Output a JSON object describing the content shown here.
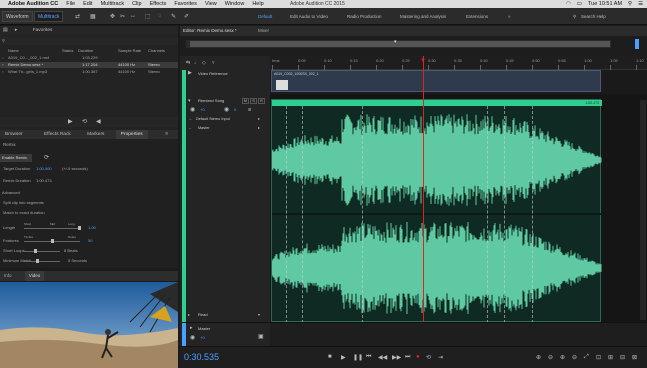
{
  "menubar": {
    "app": "Adobe Audition CC",
    "items": [
      "File",
      "Edit",
      "Multitrack",
      "Clip",
      "Effects",
      "Favorites",
      "View",
      "Window",
      "Help"
    ],
    "title": "Adobe Audition CC 2015",
    "clock": "Tue 10:51 AM"
  },
  "toolbar": {
    "waveform": "Waveform",
    "multitrack": "Multitrack",
    "workspaces": [
      "Default",
      "Edit Audio to Video",
      "Radio Production",
      "Mastering and Analysis",
      "Extensions"
    ],
    "search": "Search Help"
  },
  "files": {
    "title": "Favorites",
    "cols": [
      "Name",
      "Status",
      "Duration",
      "Sample Rate",
      "Channels"
    ],
    "rows": [
      {
        "name": "A019_C0..._002_1.mxf",
        "status": "",
        "duration": "1:03.229",
        "rate": "",
        "ch": ""
      },
      {
        "name": "Remix Demo.sesx *",
        "status": "",
        "duration": "1:17.204",
        "rate": "44100 Hz",
        "ch": "Stereo"
      },
      {
        "name": "What Th...girls_1.mp3",
        "status": "",
        "duration": "1:00.367",
        "rate": "44100 Hz",
        "ch": "Stereo"
      }
    ]
  },
  "props": {
    "tabs": [
      "Browser",
      "Effects Rack",
      "Markers",
      "Properties"
    ],
    "section": "Remix",
    "remix_btn": "Enable Remix",
    "target_label": "Target Duration",
    "target_val": "1:00.000",
    "target_note": "(+/-5 seconds)",
    "remix_dur_label": "Remix Duration",
    "remix_dur_val": "1:00.473",
    "advanced": "Advanced",
    "adv_items": [
      "Split clip into segments",
      "Match to exact duration"
    ],
    "sliders": [
      {
        "label": "Length",
        "min": "Short",
        "mid": "Mid",
        "max": "Long",
        "val": "1.00"
      },
      {
        "label": "Features",
        "min": "Timbre",
        "mid": "",
        "max": "Notes",
        "val": "50"
      },
      {
        "label": "Short Loops",
        "val": "8 Beats"
      },
      {
        "label": "Minimum Match",
        "val": "5 Seconds"
      }
    ]
  },
  "bottom_tabs": [
    "Info",
    "Video"
  ],
  "editor": {
    "tab": "Editor: Remix Demo.sesx *",
    "mixer": "Mixer",
    "ruler": [
      "hms",
      "0:05",
      "0:10",
      "0:15",
      "0:20",
      "0:25",
      "0:30",
      "0:35",
      "0:40",
      "0:45",
      "0:50",
      "0:55",
      "1:00",
      "1:05",
      "1:10"
    ],
    "video_track": "Video Reference",
    "video_clip": "A019_C002_1000SS_002_1",
    "track_name": "Remixed Song",
    "input": "Default Stereo Input",
    "master": "Master",
    "read": "Read",
    "master_track": "Master",
    "clip_time": "1:00.473",
    "timecode": "0:30.535"
  },
  "colors": {
    "accent": "#2ecf8f",
    "wave": "#5ec9a3",
    "playhead": "#e22222",
    "blue": "#4aa0ff"
  }
}
